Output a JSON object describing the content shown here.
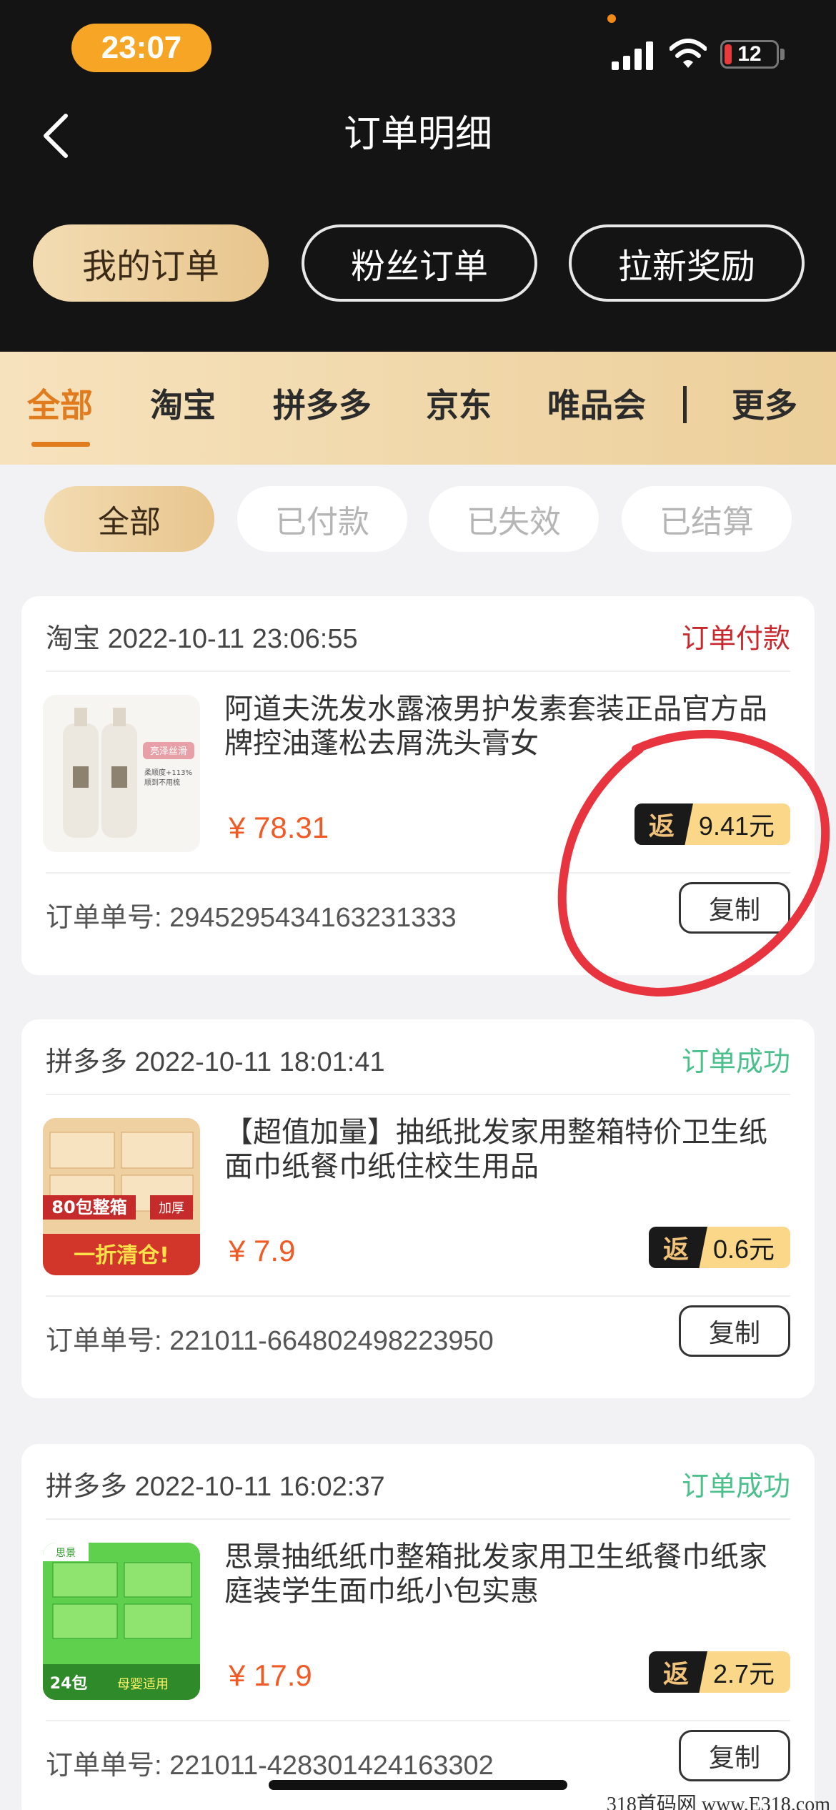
{
  "status_bar": {
    "time": "23:07",
    "battery": "12"
  },
  "header": {
    "title": "订单明细",
    "segments": [
      "我的订单",
      "粉丝订单",
      "拉新奖励"
    ]
  },
  "platform_tabs": [
    "全部",
    "淘宝",
    "拼多多",
    "京东",
    "唯品会",
    "更多"
  ],
  "status_chips": [
    "全部",
    "已付款",
    "已失效",
    "已结算"
  ],
  "orders": [
    {
      "platform": "淘宝",
      "datetime": "2022-10-11 23:06:55",
      "status": "订单付款",
      "name": "阿道夫洗发水露液男护发素套装正品官方品牌控油蓬松去屑洗头膏女",
      "price": "¥ 78.31",
      "rebate_label": "返",
      "rebate": "9.41元",
      "order_label": "订单单号:",
      "order_no": "2945295434163231333",
      "copy": "复制",
      "thumb_text_1": "亮泽丝滑",
      "thumb_text_2": "柔顺度+113%",
      "thumb_text_3": "顺到不用梳"
    },
    {
      "platform": "拼多多",
      "datetime": "2022-10-11 18:01:41",
      "status": "订单成功",
      "name": "【超值加量】抽纸批发家用整箱特价卫生纸面巾纸餐巾纸住校生用品",
      "price": "¥ 7.9",
      "rebate_label": "返",
      "rebate": "0.6元",
      "order_label": "订单单号:",
      "order_no": "221011-664802498223950",
      "copy": "复制",
      "thumb_text_1": "80包整箱",
      "thumb_text_2": "一折清仓!",
      "thumb_text_3": "加厚"
    },
    {
      "platform": "拼多多",
      "datetime": "2022-10-11 16:02:37",
      "status": "订单成功",
      "name": "思景抽纸纸巾整箱批发家用卫生纸餐巾纸家庭装学生面巾纸小包实惠",
      "price": "¥ 17.9",
      "rebate_label": "返",
      "rebate": "2.7元",
      "order_label": "订单单号:",
      "order_no": "221011-428301424163302",
      "copy": "复制",
      "thumb_text_1": "24包",
      "thumb_text_2": "母婴适用",
      "thumb_text_3": "思景"
    }
  ],
  "watermark": "318首码网 www.E318.com",
  "colors": {
    "accent": "#e07b1e",
    "price": "#f15a24",
    "paid": "#c8282d",
    "success": "#4bbf8c",
    "gold": "#e8c58d"
  }
}
